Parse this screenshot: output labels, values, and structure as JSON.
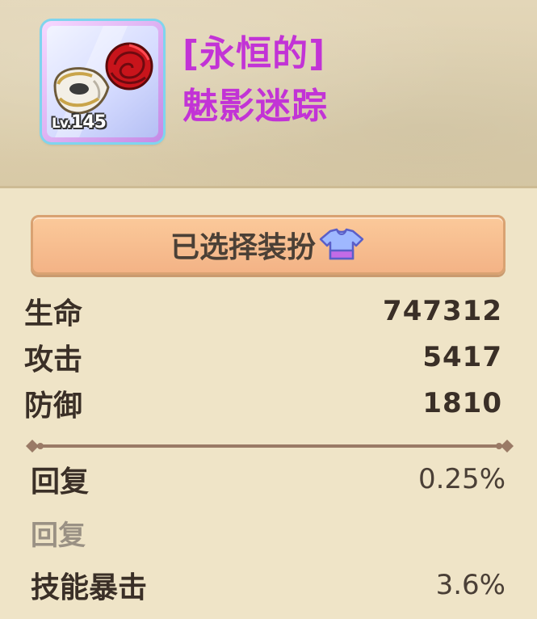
{
  "item": {
    "level_prefix": "Lv.",
    "level": "145",
    "title_line1": "[永恒的]",
    "title_line2": "魅影迷踪",
    "title_color": "#c233d6",
    "frame_color": "#c58ae6",
    "icon": "phantom-mask-rose-icon"
  },
  "select_button": {
    "label": "已选择装扮",
    "icon": "costume-shirt-icon"
  },
  "stats": [
    {
      "name": "生命",
      "value": "747312"
    },
    {
      "name": "攻击",
      "value": "5417"
    },
    {
      "name": "防御",
      "value": "1810"
    }
  ],
  "sub_stats": [
    {
      "name": "回复",
      "value": "0.25%"
    },
    {
      "name": "回复",
      "value": ""
    },
    {
      "name": "技能暴击",
      "value": "3.6%"
    }
  ]
}
